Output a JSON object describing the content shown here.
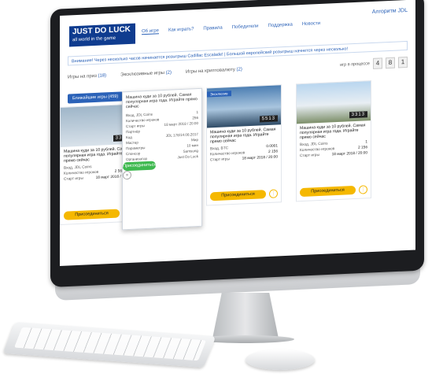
{
  "header": {
    "logo_line1": "JUST DO LUCK",
    "logo_line2": "all world in the game",
    "nav": [
      "Об игре",
      "Как играть?",
      "Правила",
      "Победители",
      "Поддержка",
      "Новости"
    ],
    "algo": "Алгоритм JDL",
    "algo_sub": ""
  },
  "ticker": "Внимание! Через несколько часов начинается розыгрыш Cadillac Escalade!  |  Большой европейский розыгрыш начнется через несколько!",
  "tabs": {
    "prize": "Игры на приз",
    "prize_count": "(18)",
    "exclusive": "Эксклюзивные игры",
    "exclusive_count": "(2)",
    "crypto": "Игры на криптовалюту",
    "crypto_count": "(2)"
  },
  "in_process": {
    "label": "игр в процессе",
    "digits": [
      "4",
      "8",
      "1"
    ]
  },
  "nearest_chip": "Ближайшие игры (459)",
  "cards": [
    {
      "desc": "Машина куди за 10 рублей. Самая популярная игра года. Играйте прямо сейчас",
      "rows": [
        [
          "Вход, JDL Coins",
          "1"
        ],
        [
          "Количество игроков",
          "2 563 645"
        ],
        [
          "Старт игры",
          "18 март 2018 / 20:00"
        ]
      ],
      "counter": "3313",
      "join": "Присоединиться"
    },
    {
      "desc": "Машина куди за 10 рублей. Самая популярная игра года. Играйте прямо сейчас",
      "rows": [
        [
          "Вход, BTC",
          "0.0001"
        ],
        [
          "Количество игроков",
          "2 156"
        ],
        [
          "Старт игры",
          "18 март 2018 / 20:00"
        ]
      ],
      "counter": "5513",
      "badge": "Эксклюзив",
      "join": "Присоединиться"
    },
    {
      "desc": "Машина куди за 10 рублей. Самая популярная игра года. Играйте прямо сейчас",
      "rows": [
        [
          "Вход, JDL Coins",
          "1"
        ],
        [
          "Количество игроков",
          "2 156"
        ],
        [
          "Старт игры",
          "18 март 2018 / 20:00"
        ]
      ],
      "counter": "3313",
      "join": "Присоединиться"
    }
  ],
  "popup": {
    "desc": "Машина куди за 10 рублей. Самая популярная игра года. Играйте прямо сейчас",
    "rows": [
      [
        "Вход, JDL Coins",
        "1"
      ],
      [
        "Количество игроков",
        "256"
      ],
      [
        "Старт игры",
        "18 март 2018 / 20:00"
      ],
      [
        "Партнёр",
        ""
      ],
      [
        "Код",
        "JDL 178/14.08.2017"
      ],
      [
        "Мастер",
        "Мир"
      ],
      [
        "Параметры",
        "10 мин"
      ],
      [
        "Спонсор",
        "Samsung"
      ],
      [
        "Организатор",
        "Just Do Luck"
      ]
    ],
    "join": "Присоединиться"
  }
}
